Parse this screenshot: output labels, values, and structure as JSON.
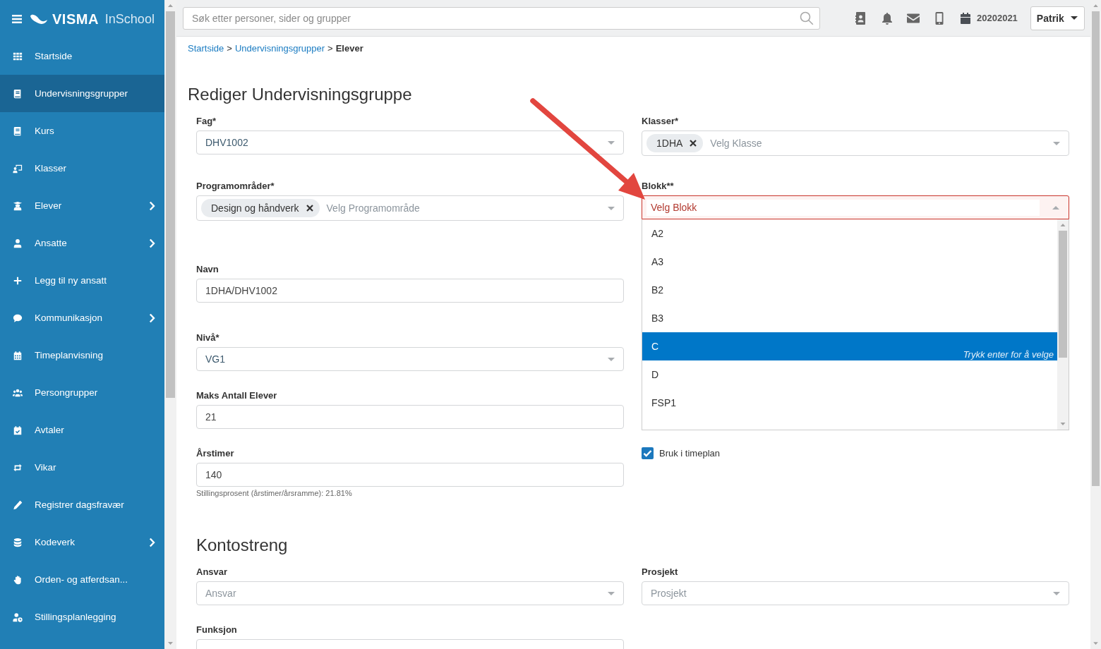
{
  "sidebar": {
    "brand": {
      "name": "VISMA",
      "product": "InSchool"
    },
    "items": [
      {
        "label": "Startside",
        "selected": false,
        "has_submenu": false
      },
      {
        "label": "Undervisningsgrupper",
        "selected": true,
        "has_submenu": false
      },
      {
        "label": "Kurs",
        "selected": false,
        "has_submenu": false
      },
      {
        "label": "Klasser",
        "selected": false,
        "has_submenu": false
      },
      {
        "label": "Elever",
        "selected": false,
        "has_submenu": true
      },
      {
        "label": "Ansatte",
        "selected": false,
        "has_submenu": true
      },
      {
        "label": "Legg til ny ansatt",
        "selected": false,
        "has_submenu": false
      },
      {
        "label": "Kommunikasjon",
        "selected": false,
        "has_submenu": true
      },
      {
        "label": "Timeplanvisning",
        "selected": false,
        "has_submenu": false
      },
      {
        "label": "Persongrupper",
        "selected": false,
        "has_submenu": false
      },
      {
        "label": "Avtaler",
        "selected": false,
        "has_submenu": false
      },
      {
        "label": "Vikar",
        "selected": false,
        "has_submenu": false
      },
      {
        "label": "Registrer dagsfravær",
        "selected": false,
        "has_submenu": false
      },
      {
        "label": "Kodeverk",
        "selected": false,
        "has_submenu": true
      },
      {
        "label": "Orden- og atferdsan...",
        "selected": false,
        "has_submenu": false
      },
      {
        "label": "Stillingsplanlegging",
        "selected": false,
        "has_submenu": false
      }
    ]
  },
  "topbar": {
    "search": {
      "placeholder": "Søk etter personer, sider og grupper"
    },
    "school_year": "20202021",
    "user": "Patrik"
  },
  "breadcrumb": [
    {
      "label": "Startside",
      "kind": "link"
    },
    {
      "label": ">",
      "kind": "separator"
    },
    {
      "label": "Undervisningsgrupper",
      "kind": "link"
    },
    {
      "label": ">",
      "kind": "separator"
    },
    {
      "label": "Elever",
      "kind": "current"
    }
  ],
  "page_title": "Rediger Undervisningsgruppe",
  "form": {
    "columns": [
      [
        {
          "kind": "select",
          "label": "Fag*",
          "value": "DHV1002"
        },
        {
          "kind": "multiselect",
          "label": "Programområder*",
          "chips": [
            "Design og håndverk"
          ],
          "placeholder": "Velg Programområde"
        },
        {
          "kind": "input",
          "label": "Navn",
          "value": "1DHA/DHV1002"
        },
        {
          "kind": "select",
          "label": "Nivå*",
          "value": "VG1"
        },
        {
          "kind": "input",
          "label": "Maks Antall Elever",
          "value": "21"
        },
        {
          "kind": "input",
          "label": "Årstimer",
          "value": "140",
          "help": "Stillingsprosent (årstimer/årsramme): 21.81%"
        }
      ],
      [
        {
          "kind": "multiselect",
          "label": "Klasser*",
          "chips": [
            "1DHA"
          ],
          "placeholder": "Velg Klasse"
        },
        {
          "kind": "select",
          "label": "Blokk**",
          "placeholder": "Velg Blokk",
          "expanded": true,
          "invalid": true,
          "options": [
            {
              "label": "A2",
              "selected": false
            },
            {
              "label": "A3",
              "selected": false
            },
            {
              "label": "B2",
              "selected": false
            },
            {
              "label": "B3",
              "selected": false
            },
            {
              "label": "C",
              "selected": true,
              "hint": "Trykk enter for å velge"
            },
            {
              "label": "D",
              "selected": false
            },
            {
              "label": "FSP1",
              "selected": false
            }
          ]
        },
        {
          "kind": "checkbox",
          "label": "Bruk i timeplan",
          "checked": true
        }
      ]
    ]
  },
  "sections": [
    {
      "heading": "Kontostreng",
      "rows": [
        [
          {
            "kind": "select",
            "label": "Ansvar",
            "placeholder": "Ansvar"
          },
          {
            "kind": "select",
            "label": "Prosjekt",
            "placeholder": "Prosjekt"
          }
        ],
        [
          {
            "kind": "select",
            "label": "Funksjon"
          }
        ]
      ]
    }
  ],
  "annotations": [
    {
      "kind": "arrow"
    }
  ]
}
